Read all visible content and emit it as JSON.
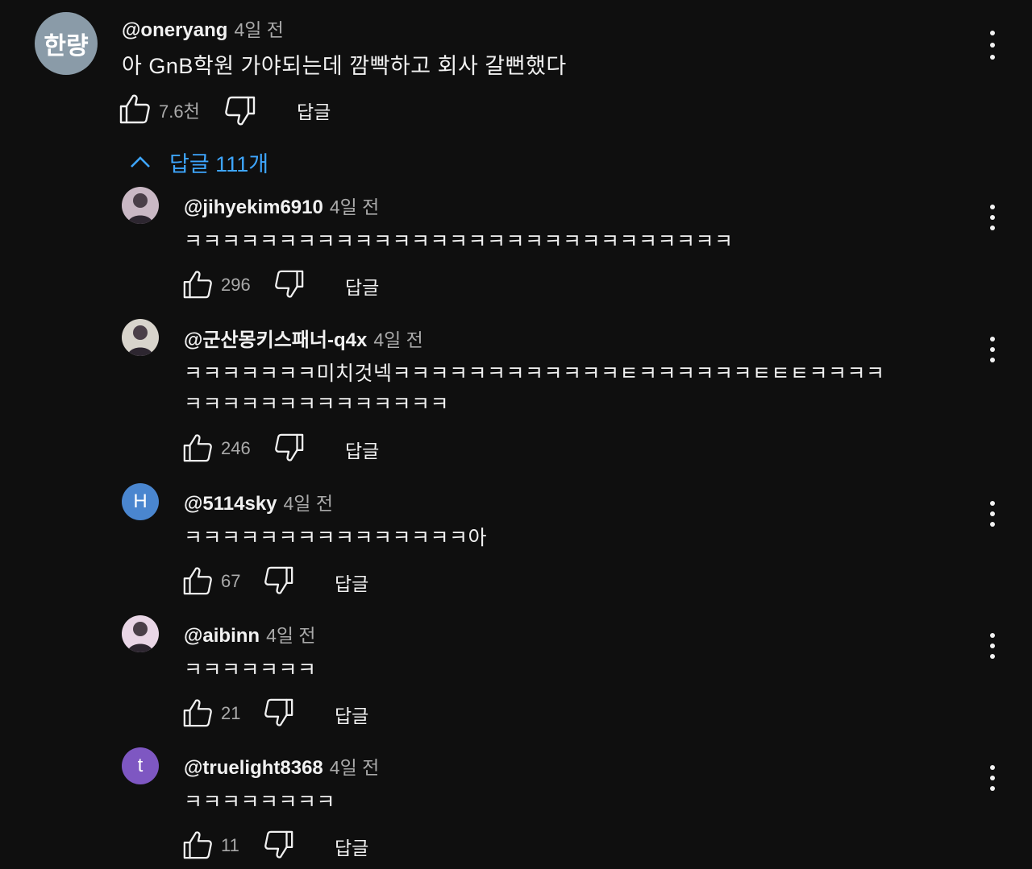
{
  "top_comment": {
    "avatar_text": "한량",
    "avatar_color": "#8a9ba8",
    "handle": "@oneryang",
    "time": "4일 전",
    "text": "아 GnB학원 가야되는데 깜빡하고 회사 갈뻔했다",
    "likes": "7.6천",
    "reply_label": "답글"
  },
  "replies_toggle": {
    "label": "답글 111개",
    "color": "#3ea6ff"
  },
  "replies": [
    {
      "handle": "@jihyekim6910",
      "time": "4일 전",
      "lines": [
        "ㅋㅋㅋㅋㅋㅋㅋㅋㅋㅋㅋㅋㅋㅋㅋㅋㅋㅋㅋㅋㅋㅋㅋㅋㅋㅋㅋㅋㅋ"
      ],
      "likes": "296",
      "reply_label": "답글",
      "avatar": "photo",
      "avatar_color": "#c9b8c4"
    },
    {
      "handle": "@군산몽키스패너-q4x",
      "time": "4일 전",
      "lines": [
        "ㅋㅋㅋㅋㅋㅋㅋ미치것넥ㅋㅋㅋㅋㅋㅋㅋㅋㅋㅋㅋㅋㅌㅋㅋㅋㅋㅋㅋㅌㅌㅌㅋㅋㅋㅋ",
        "ㅋㅋㅋㅋㅋㅋㅋㅋㅋㅋㅋㅋㅋㅋ"
      ],
      "likes": "246",
      "reply_label": "답글",
      "avatar": "photo",
      "avatar_color": "#d8d4cc"
    },
    {
      "handle": "@5114sky",
      "time": "4일 전",
      "lines": [
        "ㅋㅋㅋㅋㅋㅋㅋㅋㅋㅋㅋㅋㅋㅋㅋ아"
      ],
      "likes": "67",
      "reply_label": "답글",
      "avatar": "letter",
      "avatar_text": "H",
      "avatar_color": "#4a86cf"
    },
    {
      "handle": "@aibinn",
      "time": "4일 전",
      "lines": [
        "ㅋㅋㅋㅋㅋㅋㅋ"
      ],
      "likes": "21",
      "reply_label": "답글",
      "avatar": "photo",
      "avatar_color": "#e9d6e6"
    },
    {
      "handle": "@truelight8368",
      "time": "4일 전",
      "lines": [
        "ㅋㅋㅋㅋㅋㅋㅋㅋ"
      ],
      "likes": "11",
      "reply_label": "답글",
      "avatar": "letter",
      "avatar_text": "t",
      "avatar_color": "#7e57c2"
    }
  ]
}
